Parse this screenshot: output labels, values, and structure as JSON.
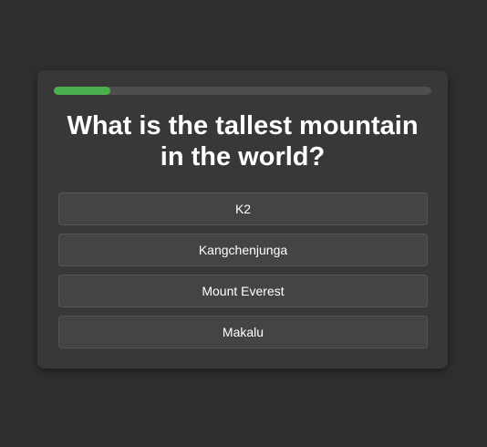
{
  "quiz": {
    "progress_fraction": 0.15,
    "progress_color": "#4caf50",
    "question": "What is the tallest mountain in the world?",
    "answers": [
      {
        "label": "K2"
      },
      {
        "label": "Kangchenjunga"
      },
      {
        "label": "Mount Everest"
      },
      {
        "label": "Makalu"
      }
    ]
  }
}
